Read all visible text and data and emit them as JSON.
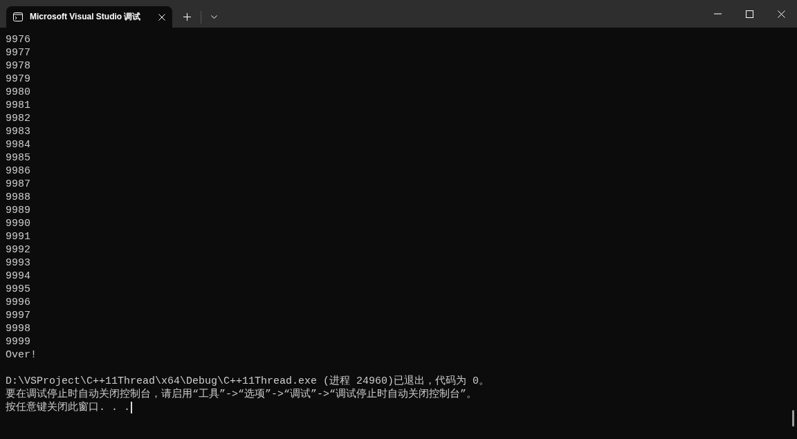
{
  "window": {
    "tab_title": "Microsoft Visual Studio 调试"
  },
  "console": {
    "program_output": [
      "9976",
      "9977",
      "9978",
      "9979",
      "9980",
      "9981",
      "9982",
      "9983",
      "9984",
      "9985",
      "9986",
      "9987",
      "9988",
      "9989",
      "9990",
      "9991",
      "9992",
      "9993",
      "9994",
      "9995",
      "9996",
      "9997",
      "9998",
      "9999",
      "Over!"
    ],
    "exit_message": [
      "D:\\VSProject\\C++11Thread\\x64\\Debug\\C++11Thread.exe (进程 24960)已退出，代码为 0。",
      "要在调试停止时自动关闭控制台，请启用“工具”->“选项”->“调试”->“调试停止时自动关闭控制台”。",
      "按任意键关闭此窗口. . ."
    ],
    "cursor_visible": true
  }
}
